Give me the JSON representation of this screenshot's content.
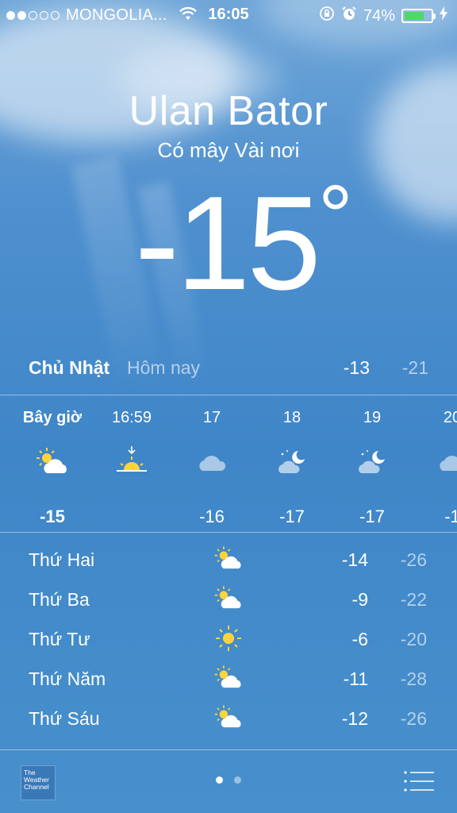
{
  "status_bar": {
    "signal_dots_filled": 2,
    "signal_dots_total": 5,
    "carrier": "MONGOLIA...",
    "time": "16:05",
    "battery_percent": "74%",
    "battery_level": 0.74,
    "battery_color": "#4cd964"
  },
  "location": {
    "city": "Ulan Bator",
    "condition": "Có mây Vài nơi",
    "temperature": "-15",
    "degree_symbol": "°"
  },
  "today": {
    "day": "Chủ Nhật",
    "label": "Hôm nay",
    "high": "-13",
    "low": "-21"
  },
  "hourly": [
    {
      "time": "Bây giờ",
      "icon": "partly-cloudy-sun-icon",
      "temp": "-15"
    },
    {
      "time": "16:59",
      "icon": "sunset-icon",
      "temp": ""
    },
    {
      "time": "17",
      "icon": "cloud-icon",
      "temp": "-16"
    },
    {
      "time": "18",
      "icon": "partly-cloudy-night-icon",
      "temp": "-17"
    },
    {
      "time": "19",
      "icon": "partly-cloudy-night-icon",
      "temp": "-17"
    },
    {
      "time": "20",
      "icon": "cloud-icon",
      "temp": "-1"
    }
  ],
  "daily": [
    {
      "day": "Thứ Hai",
      "icon": "partly-cloudy-sun-icon",
      "high": "-14",
      "low": "-26"
    },
    {
      "day": "Thứ Ba",
      "icon": "partly-cloudy-sun-icon",
      "high": "-9",
      "low": "-22"
    },
    {
      "day": "Thứ Tư",
      "icon": "sun-icon",
      "high": "-6",
      "low": "-20"
    },
    {
      "day": "Thứ Năm",
      "icon": "partly-cloudy-sun-icon",
      "high": "-11",
      "low": "-28"
    },
    {
      "day": "Thứ Sáu",
      "icon": "partly-cloudy-sun-icon",
      "high": "-12",
      "low": "-26"
    }
  ],
  "footer": {
    "logo_text": "The Weather Channel",
    "pages_total": 2,
    "page_current": 1
  }
}
